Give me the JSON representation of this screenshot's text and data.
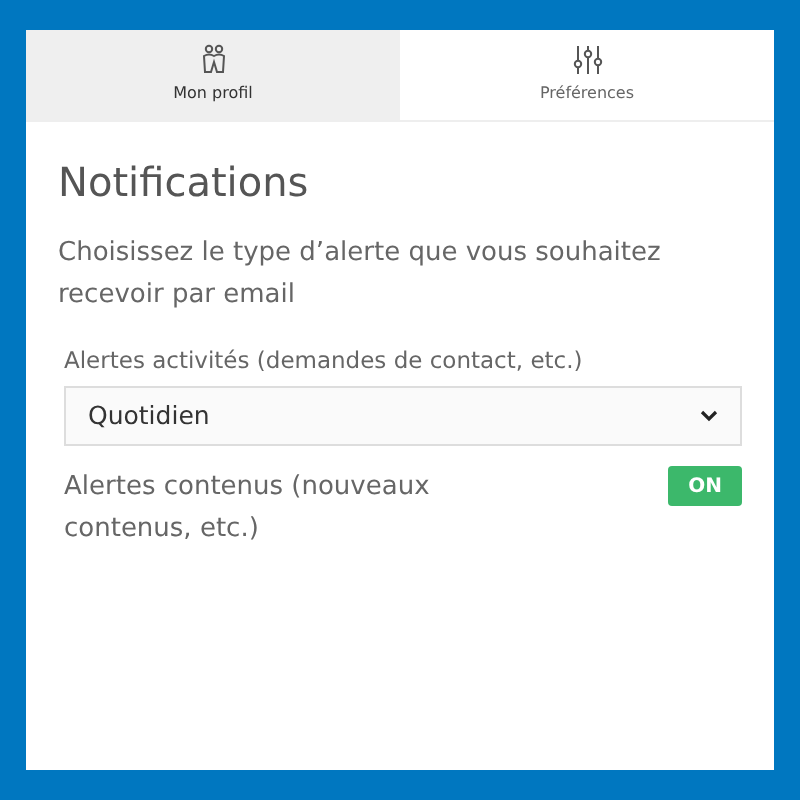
{
  "tabs": [
    {
      "label": "Mon profil",
      "selected": true,
      "kind": "people"
    },
    {
      "label": "Préférences",
      "selected": false,
      "kind": "sliders"
    }
  ],
  "section": {
    "title": "Notifications",
    "description": "Choisissez le type d’alerte que vous souhaitez recevoir par email",
    "activity_alerts": {
      "label": "Alertes activités (demandes de contact, etc.)",
      "value": "Quotidien"
    },
    "content_alerts": {
      "label": "Alertes contenus (nouveaux contenus, etc.)",
      "on": true,
      "toggle_text": "ON"
    }
  }
}
